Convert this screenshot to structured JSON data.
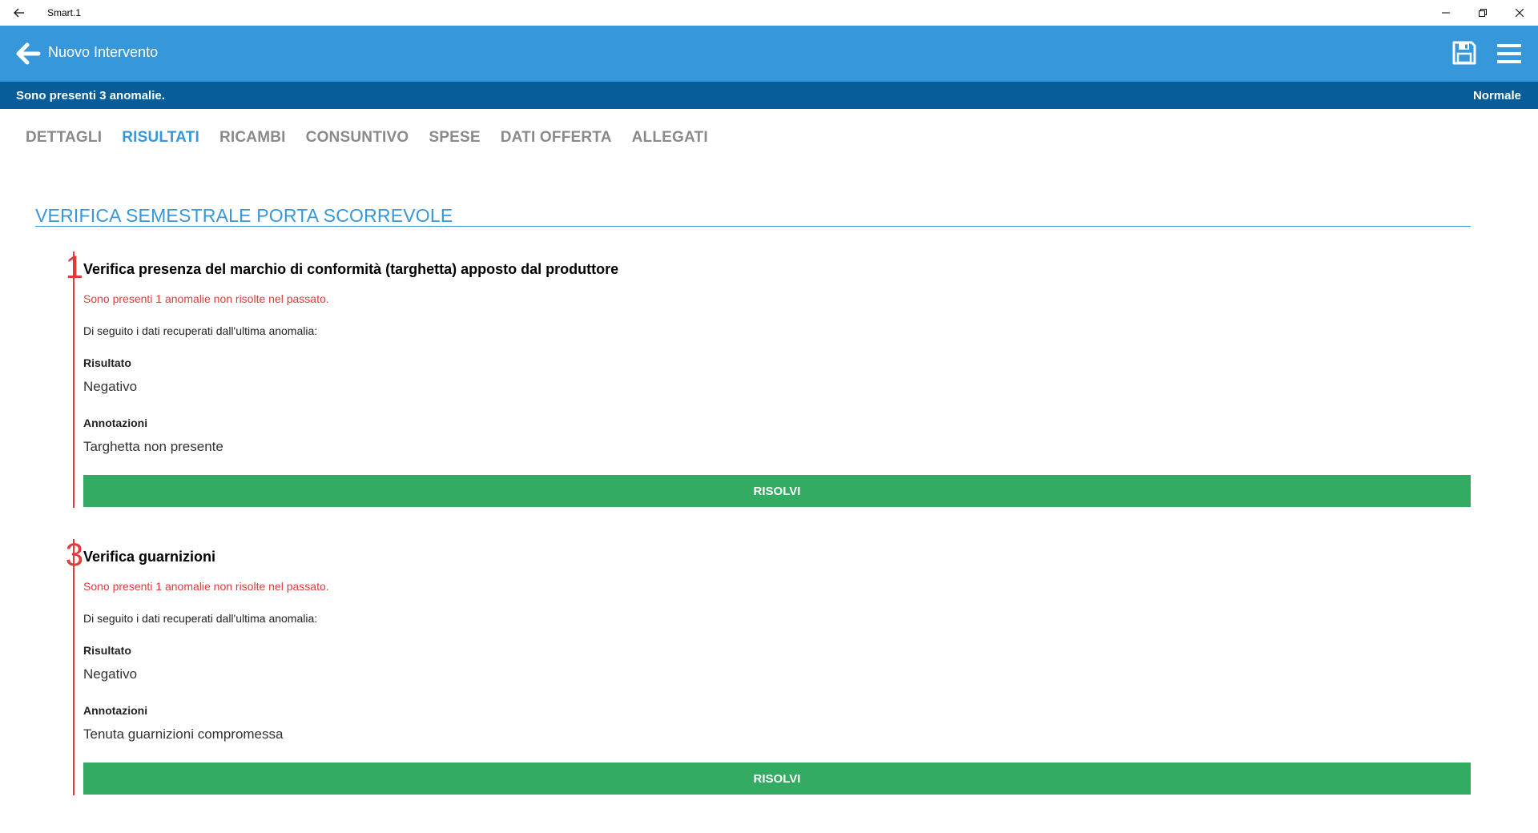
{
  "window": {
    "title": "Smart.1",
    "back_icon": "arrow-left-icon",
    "minimize_icon": "minimize-icon",
    "restore_icon": "restore-icon",
    "close_icon": "close-icon"
  },
  "appbar": {
    "title": "Nuovo Intervento",
    "back_icon": "arrow-left-icon",
    "save_icon": "save-icon",
    "menu_icon": "hamburger-icon",
    "color": "#3697db"
  },
  "statusbar": {
    "message": "Sono presenti 3 anomalie.",
    "priority": "Normale",
    "color": "#065d99"
  },
  "tabs": [
    {
      "label": "DETTAGLI",
      "active": false
    },
    {
      "label": "RISULTATI",
      "active": true
    },
    {
      "label": "RICAMBI",
      "active": false
    },
    {
      "label": "CONSUNTIVO",
      "active": false
    },
    {
      "label": "SPESE",
      "active": false
    },
    {
      "label": "DATI OFFERTA",
      "active": false
    },
    {
      "label": "ALLEGATI",
      "active": false
    }
  ],
  "section": {
    "title": "VERIFICA SEMESTRALE PORTA SCORREVOLE"
  },
  "items": [
    {
      "number": "1",
      "title": "Verifica presenza del marchio di conformità (targhetta) apposto dal produttore",
      "warning": "Sono presenti 1 anomalie non risolte nel passato.",
      "info": "Di seguito i dati recuperati dall'ultima anomalia:",
      "result_label": "Risultato",
      "result_value": "Negativo",
      "notes_label": "Annotazioni",
      "notes_value": "Targhetta non presente",
      "button_label": "RISOLVI"
    },
    {
      "number": "3",
      "title": "Verifica guarnizioni",
      "warning": "Sono presenti 1 anomalie non risolte nel passato.",
      "info": "Di seguito i dati recuperati dall'ultima anomalia:",
      "result_label": "Risultato",
      "result_value": "Negativo",
      "notes_label": "Annotazioni",
      "notes_value": "Tenuta guarnizioni compromessa",
      "button_label": "RISOLVI"
    }
  ],
  "colors": {
    "accent": "#3697db",
    "error": "#e03a3a",
    "success": "#33ab63"
  }
}
